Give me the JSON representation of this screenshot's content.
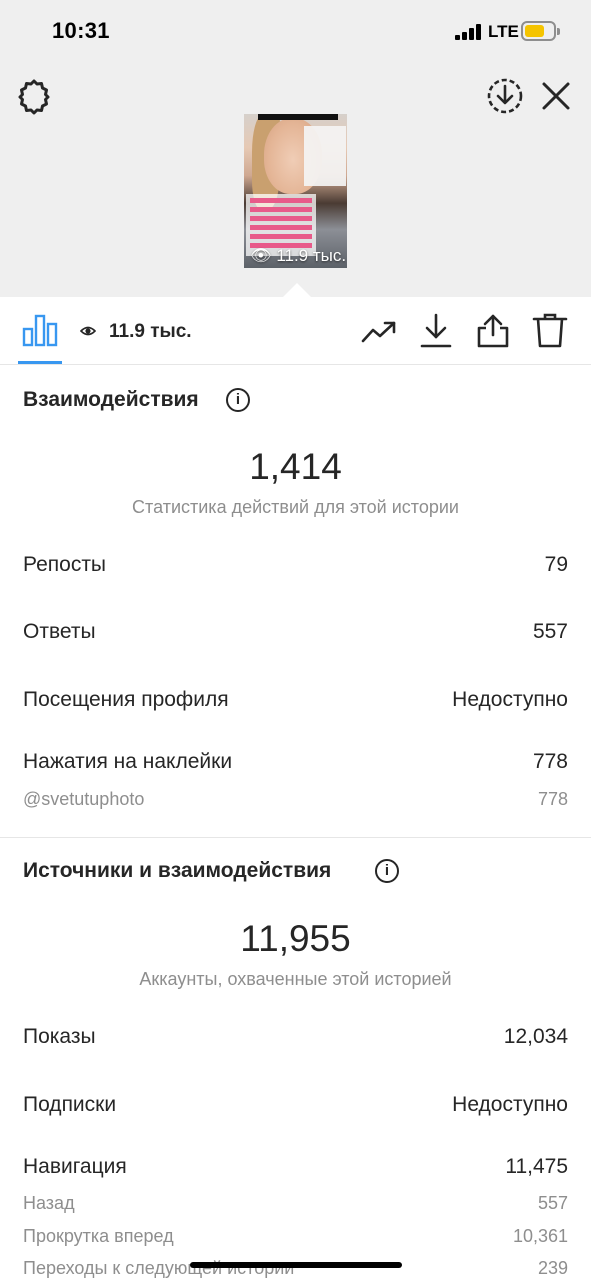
{
  "status_bar": {
    "time": "10:31",
    "network": "LTE"
  },
  "story_preview": {
    "views": "11.9 тыс."
  },
  "toolbar": {
    "views": "11.9 тыс."
  },
  "interactions": {
    "title": "Взаимодействия",
    "total": "1,414",
    "subtitle": "Статистика действий для этой истории",
    "rows": [
      {
        "label": "Репосты",
        "value": "79"
      },
      {
        "label": "Ответы",
        "value": "557"
      },
      {
        "label": "Посещения профиля",
        "value": "Недоступно"
      },
      {
        "label": "Нажатия на наклейки",
        "value": "778"
      }
    ],
    "sticker_sub": {
      "label": "@svetutuphoto",
      "value": "778"
    }
  },
  "discovery": {
    "title": "Источники и взаимодействия",
    "total": "11,955",
    "subtitle": "Аккаунты, охваченные этой историей",
    "rows": [
      {
        "label": "Показы",
        "value": "12,034"
      },
      {
        "label": "Подписки",
        "value": "Недоступно"
      },
      {
        "label": "Навигация",
        "value": "11,475"
      }
    ],
    "navigation_sub": [
      {
        "label": "Назад",
        "value": "557"
      },
      {
        "label": "Прокрутка вперед",
        "value": "10,361"
      },
      {
        "label": "Переходы к следующей истории",
        "value": "239"
      }
    ]
  },
  "colors": {
    "accent": "#3897f0",
    "battery": "#f5c400",
    "text": "#262626",
    "muted": "#8e8e8e"
  },
  "icons": [
    "gear-icon",
    "download-circle-icon",
    "close-icon",
    "bar-chart-icon",
    "eye-icon",
    "trend-icon",
    "download-icon",
    "share-icon",
    "trash-icon",
    "info-icon"
  ]
}
